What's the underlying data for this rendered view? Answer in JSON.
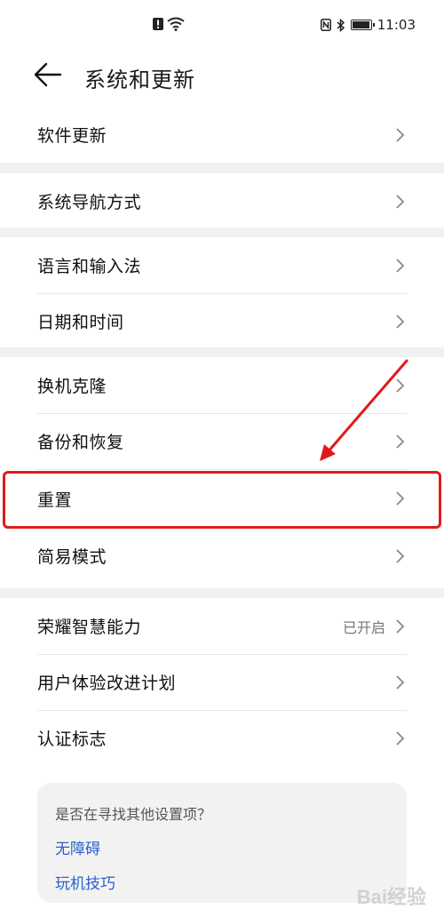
{
  "status_bar": {
    "time": "11:03"
  },
  "header": {
    "title": "系统和更新"
  },
  "groups": [
    [
      {
        "label": "软件更新"
      }
    ],
    [
      {
        "label": "系统导航方式"
      }
    ],
    [
      {
        "label": "语言和输入法"
      },
      {
        "label": "日期和时间"
      }
    ],
    [
      {
        "label": "换机克隆"
      },
      {
        "label": "备份和恢复"
      },
      {
        "label": "重置"
      },
      {
        "label": "简易模式"
      }
    ],
    [
      {
        "label": "荣耀智慧能力",
        "value": "已开启"
      },
      {
        "label": "用户体验改进计划"
      },
      {
        "label": "认证标志"
      }
    ]
  ],
  "suggest": {
    "question": "是否在寻找其他设置项？",
    "links": [
      "无障碍",
      "玩机技巧"
    ]
  },
  "colors": {
    "accent_link": "#2a62c8",
    "annotation_red": "#e01a1a"
  },
  "icons": [
    "back-arrow-icon",
    "chevron-right-icon",
    "wifi-icon",
    "bluetooth-icon",
    "battery-icon",
    "nfc-icon",
    "alert-icon"
  ],
  "watermark": "Bai经验"
}
